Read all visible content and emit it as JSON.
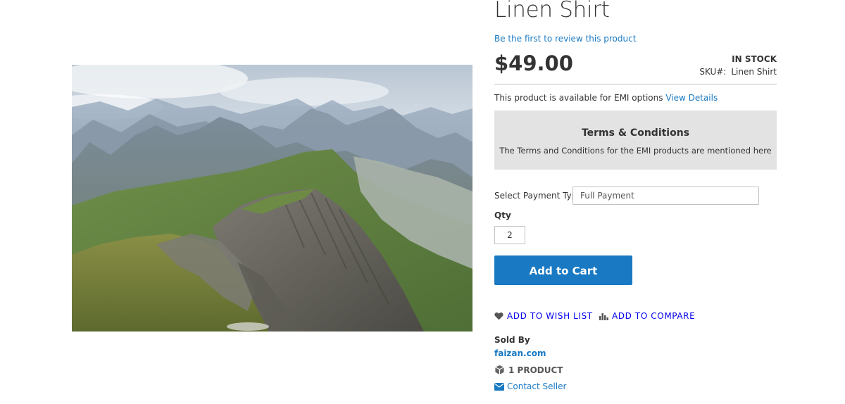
{
  "product": {
    "title": "Linen Shirt",
    "review_link": "Be the first to review this product",
    "price": "$49.00",
    "stock_status": "In stock",
    "sku_label": "SKU#:",
    "sku_value": "Linen Shirt",
    "image_icon": "mountain-landscape-image"
  },
  "emi": {
    "text": "This product is available for EMI options",
    "link": "View Details"
  },
  "terms": {
    "title": "Terms & Conditions",
    "text": "The Terms and Conditions for the EMI products are mentioned here"
  },
  "payment": {
    "label": "Select Payment Type",
    "selected": "Full Payment"
  },
  "qty": {
    "label": "Qty",
    "value": "2"
  },
  "cart": {
    "button_label": "Add to Cart"
  },
  "actions": {
    "wishlist": "Add to Wish List",
    "compare": "Add to Compare",
    "wishlist_icon": "heart-icon",
    "compare_icon": "bar-chart-icon"
  },
  "seller": {
    "sold_by_label": "Sold By",
    "name": "faizan.com",
    "product_count": "1 Product",
    "contact_label": "Contact Seller",
    "product_icon": "cube-icon",
    "contact_icon": "envelope-icon"
  },
  "colors": {
    "accent": "#1979c3",
    "terms_bg": "#e3e3e3",
    "text": "#333333"
  }
}
